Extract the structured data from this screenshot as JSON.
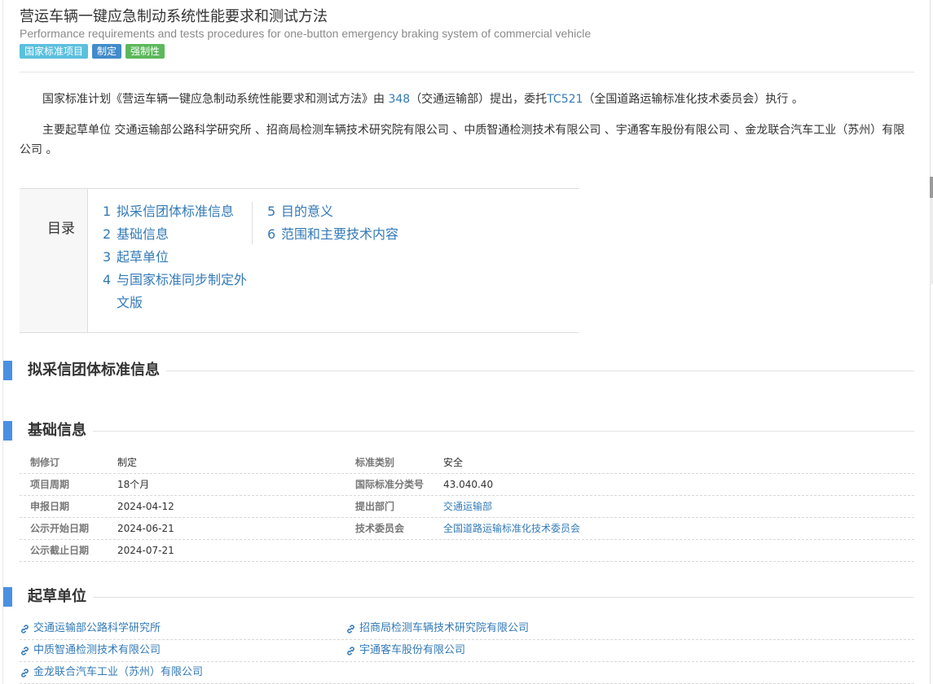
{
  "header": {
    "title": "营运车辆一键应急制动系统性能要求和测试方法",
    "subtitle": "Performance requirements and tests procedures for one-button emergency braking system of commercial vehicle",
    "badges": [
      "国家标准项目",
      "制定",
      "强制性"
    ],
    "badge_colors": [
      "#5bc0de",
      "#428bca",
      "#5cb85c"
    ]
  },
  "intro": {
    "p1_prefix": "国家标准计划《营运车辆一键应急制动系统性能要求和测试方法》由 ",
    "p1_link1": "348",
    "p1_mid": "（交通运输部）提出，委托",
    "p1_link2": "TC521",
    "p1_suffix": "（全国道路运输标准化技术委员会）执行 。",
    "p2": "主要起草单位 交通运输部公路科学研究所 、招商局检测车辆技术研究院有限公司 、中质智通检测技术有限公司 、宇通客车股份有限公司 、金龙联合汽车工业（苏州）有限公司 。"
  },
  "toc": {
    "label": "目录",
    "items": [
      {
        "num": "1",
        "text": "拟采信团体标准信息"
      },
      {
        "num": "2",
        "text": "基础信息"
      },
      {
        "num": "3",
        "text": "起草单位"
      },
      {
        "num": "4",
        "text": "与国家标准同步制定外文版"
      },
      {
        "num": "5",
        "text": "目的意义"
      },
      {
        "num": "6",
        "text": "范围和主要技术内容"
      }
    ]
  },
  "sections": {
    "s1": "拟采信团体标准信息",
    "s2": "基础信息",
    "s3": "起草单位"
  },
  "basic_info": {
    "rows": [
      {
        "k1": "制修订",
        "v1": "制定",
        "k2": "标准类别",
        "v2": "安全"
      },
      {
        "k1": "项目周期",
        "v1": "18个月",
        "k2": "国际标准分类号",
        "v2": "43.040.40"
      },
      {
        "k1": "申报日期",
        "v1": "2024-04-12",
        "k2": "提出部门",
        "v2": "交通运输部"
      },
      {
        "k1": "公示开始日期",
        "v1": "2024-06-21",
        "k2": "技术委员会",
        "v2": "全国道路运输标准化技术委员会"
      },
      {
        "k1": "公示截止日期",
        "v1": "2024-07-21",
        "k2": "",
        "v2": ""
      }
    ]
  },
  "drafters": [
    "交通运输部公路科学研究所",
    "招商局检测车辆技术研究院有限公司",
    "中质智通检测技术有限公司",
    "宇通客车股份有限公司",
    "金龙联合汽车工业（苏州）有限公司"
  ],
  "colors": {
    "accent": "#4a90e2",
    "link": "#337ab7"
  }
}
